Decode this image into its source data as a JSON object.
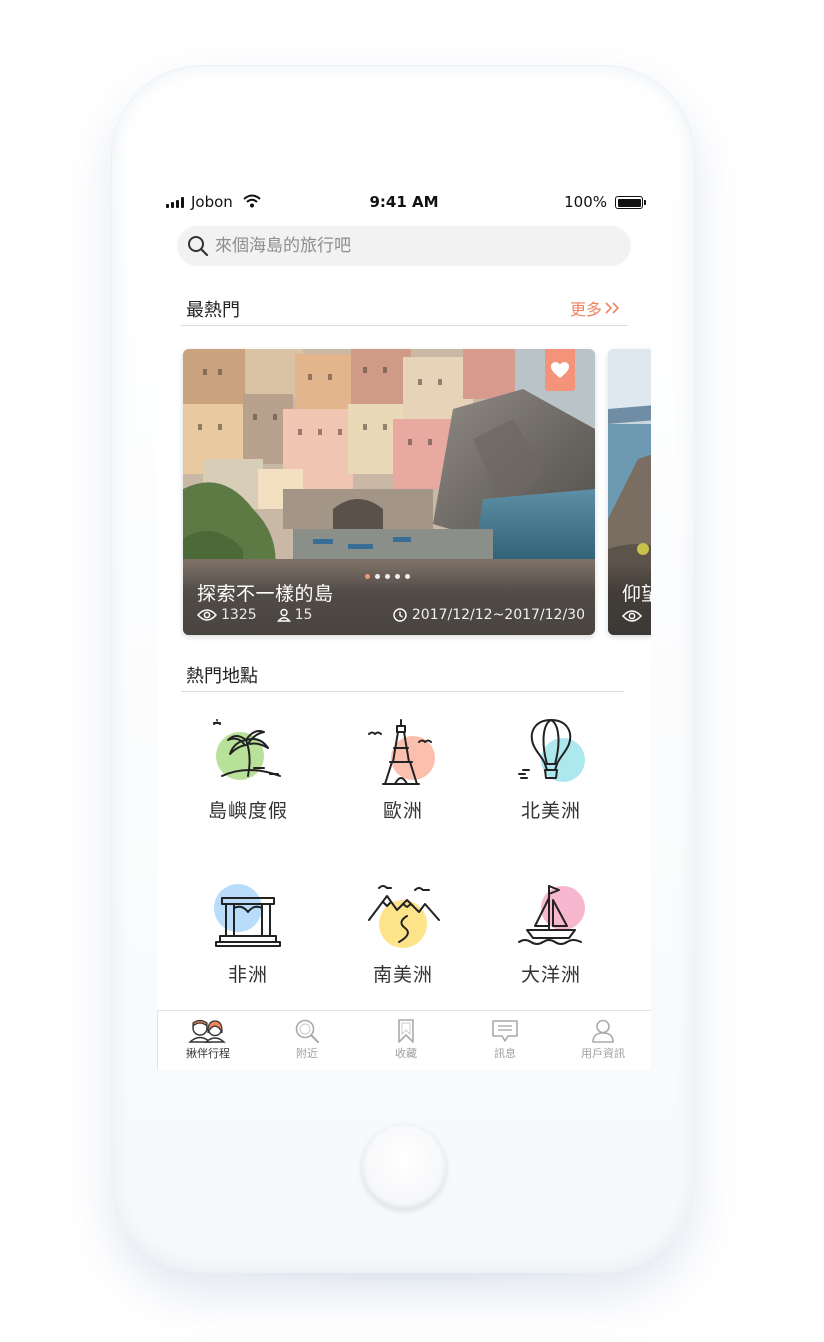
{
  "status_bar": {
    "carrier": "Jobon",
    "time": "9:41 AM",
    "battery": "100%"
  },
  "search": {
    "placeholder": "來個海島的旅行吧"
  },
  "popular": {
    "title": "最熱門",
    "more_label": "更多"
  },
  "featured_card": {
    "title": "探索不一樣的島",
    "views": "1325",
    "members": "15",
    "date_range": "2017/12/12~2017/12/30",
    "dots_total": 5,
    "dots_active": 1
  },
  "next_card": {
    "title_partial": "仰望"
  },
  "hot_places": {
    "title": "熱門地點",
    "items": [
      {
        "label": "島嶼度假",
        "icon": "palm-island-icon",
        "accent": "#b8e29a"
      },
      {
        "label": "歐洲",
        "icon": "eiffel-tower-icon",
        "accent": "#fbbfae"
      },
      {
        "label": "北美洲",
        "icon": "hot-air-balloon-icon",
        "accent": "#aee8ef"
      },
      {
        "label": "非洲",
        "icon": "temple-icon",
        "accent": "#b9dcfa"
      },
      {
        "label": "南美洲",
        "icon": "mountain-icon",
        "accent": "#fde48a"
      },
      {
        "label": "大洋洲",
        "icon": "sailboat-icon",
        "accent": "#f7b7cf"
      }
    ]
  },
  "tab_bar": {
    "tabs": [
      {
        "label": "揪伴行程",
        "icon": "companions-icon",
        "active": true
      },
      {
        "label": "附近",
        "icon": "search-icon",
        "active": false
      },
      {
        "label": "收藏",
        "icon": "bookmark-icon",
        "active": false
      },
      {
        "label": "訊息",
        "icon": "message-icon",
        "active": false
      },
      {
        "label": "用戶資訊",
        "icon": "user-icon",
        "active": false
      }
    ]
  },
  "colors": {
    "accent": "#f0845f",
    "favorite_badge": "#f4937a",
    "divider": "#dcdcdc"
  }
}
